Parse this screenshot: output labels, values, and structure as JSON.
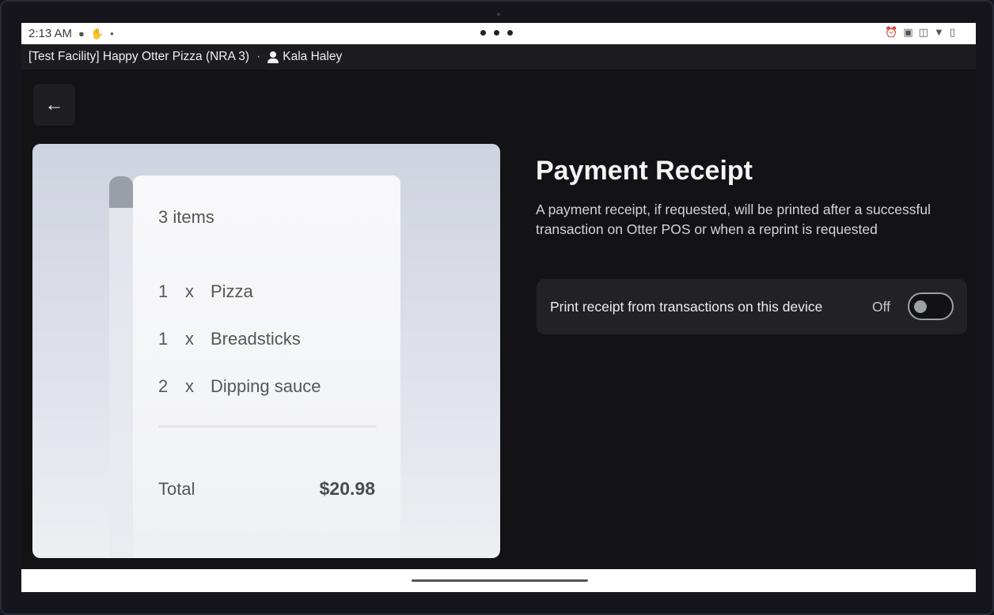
{
  "status_bar": {
    "time": "2:13 AM",
    "left_icons": [
      "check-circle-icon",
      "hand-icon",
      "dot-icon"
    ],
    "right_icons": [
      "alarm-icon",
      "cast-icon",
      "vibrate-icon",
      "wifi-icon",
      "battery-icon"
    ]
  },
  "facility_bar": {
    "facility_name": "[Test Facility] Happy Otter Pizza (NRA 3)",
    "separator": "·",
    "user_name": "Kala Haley"
  },
  "back_button": {
    "icon": "arrow-left-icon",
    "glyph": "←"
  },
  "receipt_preview": {
    "item_count": "3 items",
    "items": [
      {
        "qty": "1",
        "x": "x",
        "name": "Pizza"
      },
      {
        "qty": "1",
        "x": "x",
        "name": "Breadsticks"
      },
      {
        "qty": "2",
        "x": "x",
        "name": "Dipping sauce"
      }
    ],
    "total_label": "Total",
    "total_value": "$20.98"
  },
  "content": {
    "title": "Payment Receipt",
    "description": "A payment receipt, if requested, will be printed after a successful transaction on Otter POS or when a reprint is requested",
    "setting": {
      "label": "Print receipt from transactions on this device",
      "state_text": "Off",
      "enabled": false
    }
  },
  "colors": {
    "background": "#131316",
    "card": "#222226",
    "text_primary": "#f5f5f5",
    "text_secondary": "#d4d4d8"
  }
}
